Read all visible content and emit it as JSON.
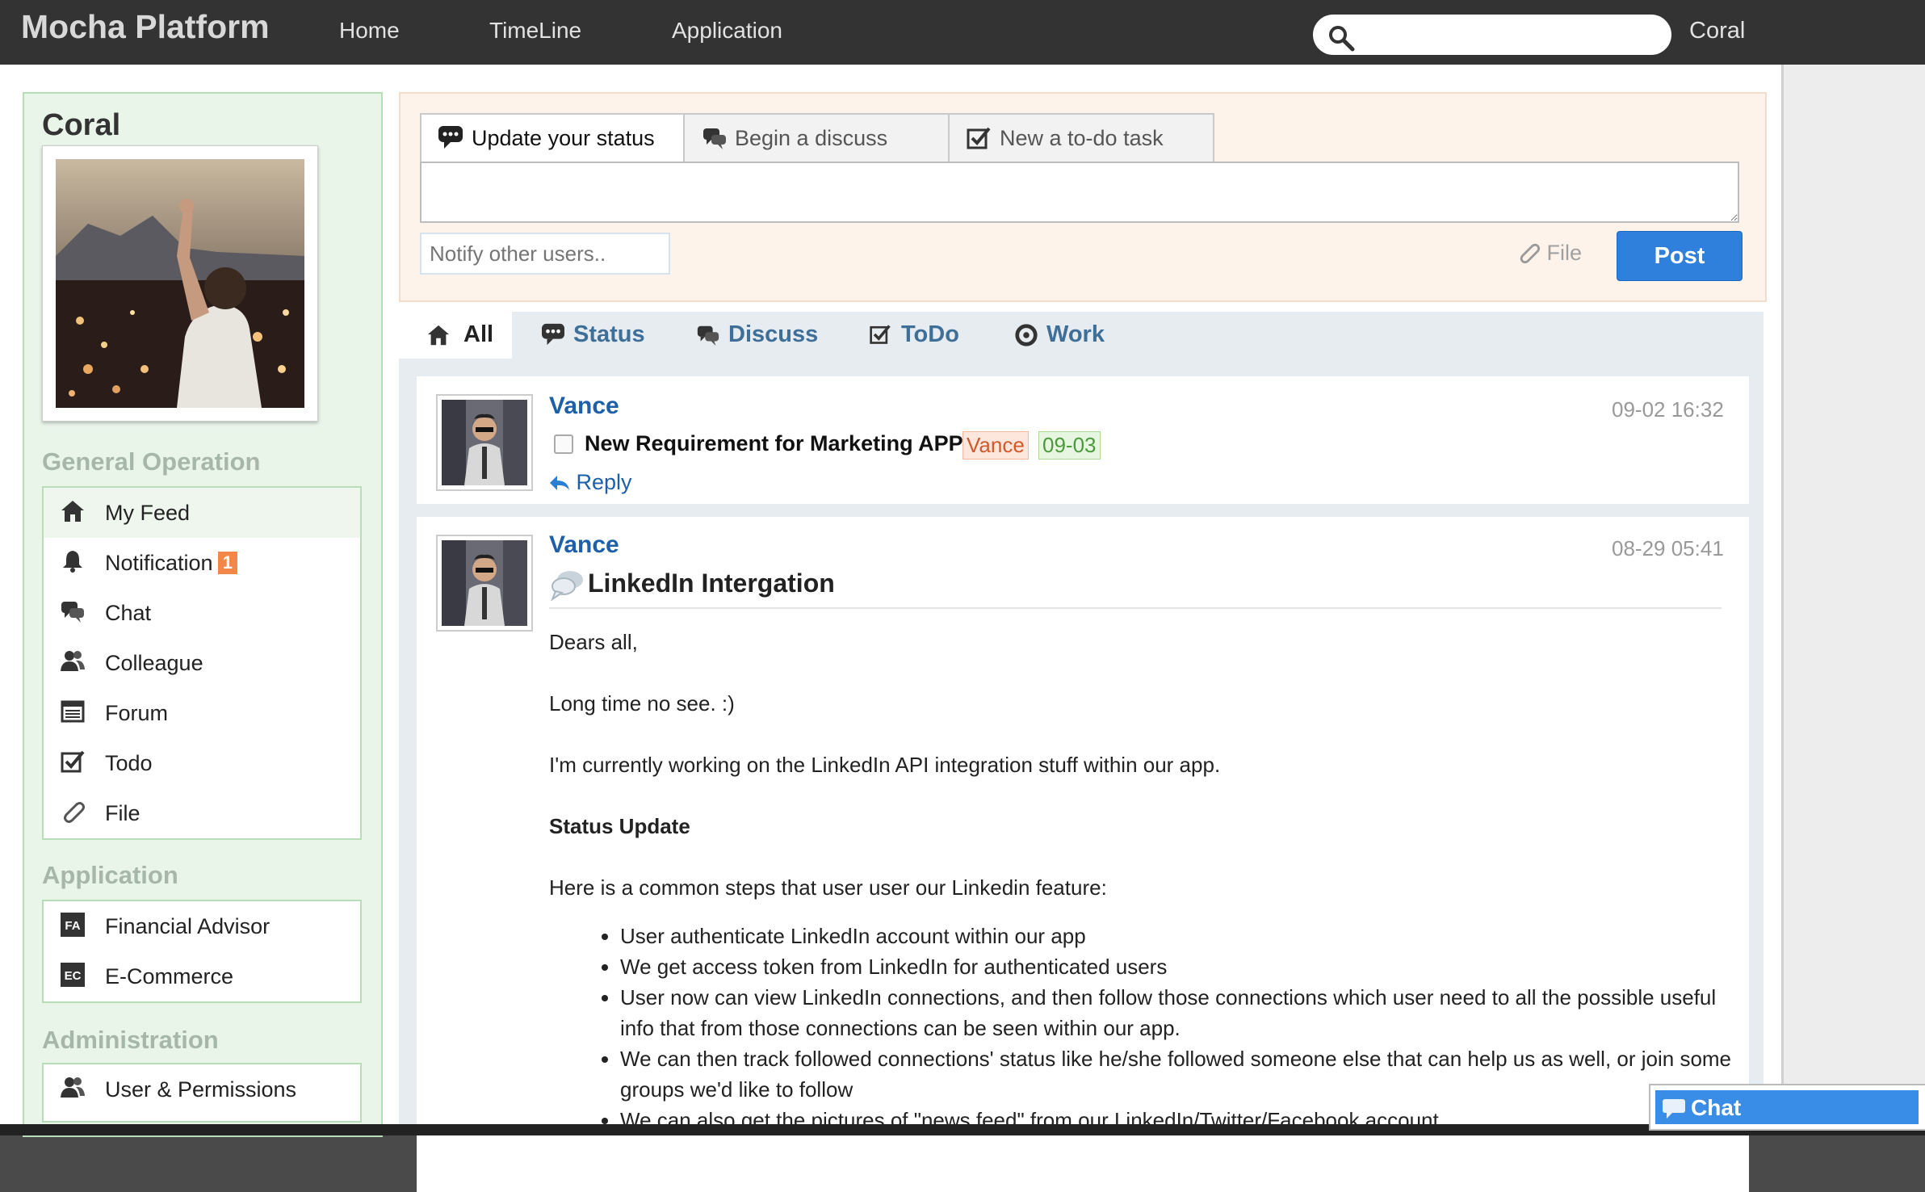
{
  "topbar": {
    "brand": "Mocha Platform",
    "nav": [
      "Home",
      "TimeLine",
      "Application"
    ],
    "search_placeholder": "",
    "user": "Coral"
  },
  "sidebar": {
    "user_name": "Coral",
    "general_title": "General Operation",
    "general_items": [
      {
        "label": "My Feed",
        "icon": "home-icon"
      },
      {
        "label": "Notification",
        "icon": "bell-icon",
        "badge": "1"
      },
      {
        "label": "Chat",
        "icon": "chat-bubbles-icon"
      },
      {
        "label": "Colleague",
        "icon": "users-icon"
      },
      {
        "label": "Forum",
        "icon": "forum-icon"
      },
      {
        "label": "Todo",
        "icon": "checkbox-icon"
      },
      {
        "label": "File",
        "icon": "paperclip-icon"
      }
    ],
    "application_title": "Application",
    "application_items": [
      {
        "label": "Financial Advisor",
        "icon_text": "FA"
      },
      {
        "label": "E-Commerce",
        "icon_text": "EC"
      }
    ],
    "admin_title": "Administration",
    "admin_items": [
      {
        "label": "User & Permissions",
        "icon": "users-icon"
      }
    ]
  },
  "composer": {
    "tabs": [
      "Update your status",
      "Begin a discuss",
      "New a to-do task"
    ],
    "status_value": "",
    "notify_placeholder": "Notify other users..",
    "file_label": "File",
    "post_label": "Post"
  },
  "filters": [
    "All",
    "Status",
    "Discuss",
    "ToDo",
    "Work"
  ],
  "feed": [
    {
      "type": "todo",
      "author": "Vance",
      "time": "09-02 16:32",
      "title": "New Requirement for Marketing APP",
      "assignee": "Vance",
      "due": "09-03",
      "reply_label": "Reply"
    },
    {
      "type": "discuss",
      "author": "Vance",
      "time": "08-29 05:41",
      "title": "LinkedIn Intergation",
      "paragraphs": [
        "Dears all,",
        "Long time no see. :)",
        "I'm currently working on the LinkedIn API integration stuff within our app.",
        "Status Update",
        "Here is a common steps that user user our Linkedin feature:"
      ],
      "bullets": [
        "User authenticate LinkedIn account within our app",
        "We get access token from LinkedIn for authenticated users",
        "User now can view LinkedIn connections, and then follow those connections which user need to all the possible useful info that from those connections can be seen within our app.",
        "We can then track followed connections' status like he/she followed someone else that can help us as well, or join some groups we'd like to follow",
        "We can also get the pictures of \"news feed\" from our LinkedIn/Twitter/Facebook account."
      ]
    }
  ],
  "chat_widget": {
    "label": "Chat"
  },
  "colors": {
    "accent_blue": "#2f7fdc",
    "link_blue": "#1d5fa8",
    "topbar": "#333333",
    "badge_orange": "#f3874a"
  }
}
